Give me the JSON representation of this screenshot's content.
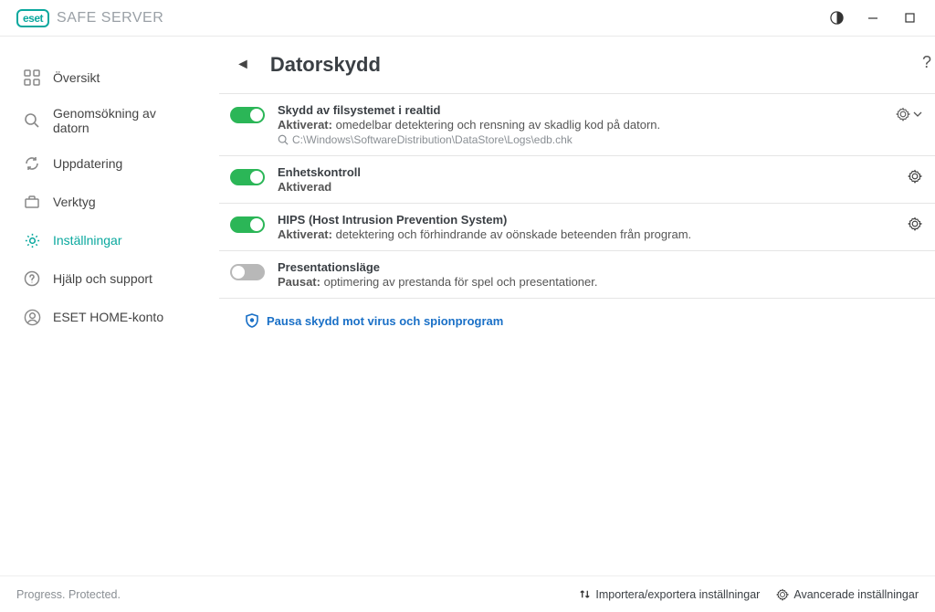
{
  "brand": {
    "badge": "eset",
    "prod": "SAFE SERVER"
  },
  "sidebar": {
    "items": [
      {
        "label": "Översikt"
      },
      {
        "label": "Genomsökning av datorn"
      },
      {
        "label": "Uppdatering"
      },
      {
        "label": "Verktyg"
      },
      {
        "label": "Inställningar"
      },
      {
        "label": "Hjälp och support"
      },
      {
        "label": "ESET HOME-konto"
      }
    ]
  },
  "page": {
    "title": "Datorskydd"
  },
  "rows": [
    {
      "title": "Skydd av filsystemet i realtid",
      "status": "Aktiverat:",
      "desc": "omedelbar detektering och rensning av skadlig kod på datorn.",
      "path": "C:\\Windows\\SoftwareDistribution\\DataStore\\Logs\\edb.chk"
    },
    {
      "title": "Enhetskontroll",
      "status": "Aktiverad",
      "desc": ""
    },
    {
      "title": "HIPS (Host Intrusion Prevention System)",
      "status": "Aktiverat:",
      "desc": "detektering och förhindrande av oönskade beteenden från program."
    },
    {
      "title": "Presentationsläge",
      "status": "Pausat:",
      "desc": "optimering av prestanda för spel och presentationer."
    }
  ],
  "pause": "Pausa skydd mot virus och spionprogram",
  "footer": {
    "slogan": "Progress. Protected.",
    "import": "Importera/exportera inställningar",
    "advanced": "Avancerade inställningar"
  }
}
